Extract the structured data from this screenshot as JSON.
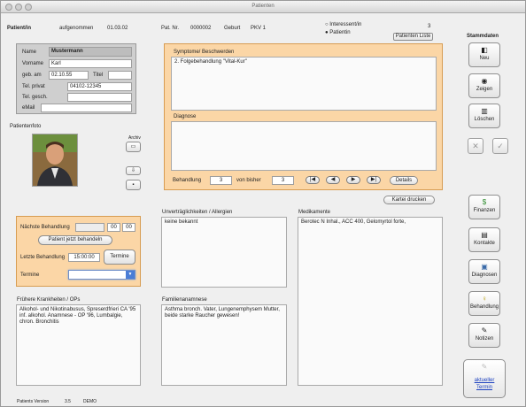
{
  "window": {
    "title": "Patienten"
  },
  "header": {
    "patient_label": "Patient/in",
    "admitted_label": "aufgenommen",
    "admitted_date": "01.03.02",
    "patnr_label": "Pat. Nr.",
    "patnr_value": "0000002",
    "geburt_label": "Geburt",
    "insurance": "PKV 1",
    "interessent_label": "Interessent/in",
    "patient_radio_label": "Patientin",
    "count": "3",
    "list_button": "Patienten Liste",
    "stammdaten_label": "Stammdaten"
  },
  "personal": {
    "name_label": "Name",
    "name_value": "Mustermann",
    "vorname_label": "Vorname",
    "vorname_value": "Karl",
    "geb_label": "geb. am",
    "geb_value": "02.10.55",
    "titel_label": "Titel",
    "tel_privat_label": "Tel. privat",
    "tel_privat_value": "04102-12345",
    "tel_gesch_label": "Tel. gesch.",
    "email_label": "eMail"
  },
  "photo": {
    "label": "Patientenfoto",
    "archiv_label": "Archiv"
  },
  "symptoms": {
    "label": "Symptome/ Beschwerden",
    "text": "2. Folgebehandlung \"Vital-Kur\"",
    "diagnose_label": "Diagnose",
    "behandlung_label": "Behandlung",
    "behandlung_value": "3",
    "von_bisher_label": "von bisher",
    "von_bisher_value": "3",
    "details_button": "Details"
  },
  "kartei_button": "Kartei drucken",
  "appointments": {
    "next_label": "Nächste Behandlung",
    "next_h": "00",
    "next_m": "00",
    "treat_now_button": "Patient jetzt behandeln",
    "last_label": "Letzte Behandlung",
    "last_time": "15:00:00",
    "termine_button": "Termine",
    "termine_label": "Termine"
  },
  "intolerances": {
    "label": "Unverträglichkeiten / Allergien",
    "text": "keine bekannt"
  },
  "medications": {
    "label": "Medikamente",
    "text": "Berotec N Inhal., ACC 400, Gelomyrtol forte,"
  },
  "history": {
    "label": "Frühere Krankheiten / OPs",
    "text": "Alkohol- und Nikotinabusus, Spreserdfrieri CA '95 inf. alkohol. Anamnese - OP '96, Lumbalgie, chron. Bronchitis"
  },
  "family": {
    "label": "Familienanamnese",
    "text": "Asthma bronch. Vater, Lungenemphysem Mutter, beide starke Raucher gewesen!"
  },
  "sidebar": {
    "neu": "Neu",
    "zeigen": "Zeigen",
    "loeschen": "Löschen",
    "finanzen": "Finanzen",
    "kontakte": "Kontakte",
    "diagnosen": "Diagnosen",
    "behandlung": "Behandlung",
    "notizen": "Notizen",
    "termin_line1": "aktueller",
    "termin_line2": "Termin"
  },
  "footer": {
    "version_label": "Patients Version",
    "version_value": "3.5",
    "mode": "DEMO"
  }
}
